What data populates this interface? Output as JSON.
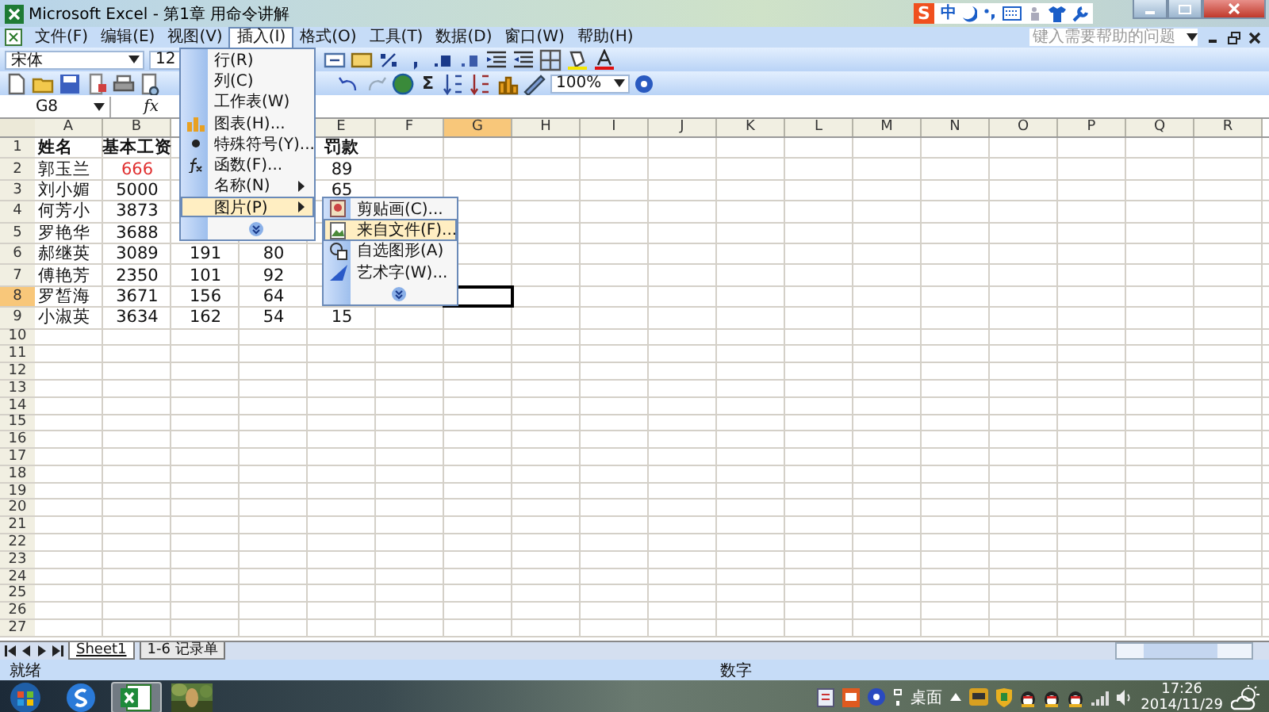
{
  "window": {
    "title": "Microsoft Excel - 第1章 用命令讲解"
  },
  "ime_bar": {
    "logo": "S",
    "mode": "中"
  },
  "menu_bar": [
    {
      "label": "文件(F)",
      "selected": false
    },
    {
      "label": "编辑(E)",
      "selected": false
    },
    {
      "label": "视图(V)",
      "selected": false
    },
    {
      "label": "插入(I)",
      "selected": true
    },
    {
      "label": "格式(O)",
      "selected": false
    },
    {
      "label": "工具(T)",
      "selected": false
    },
    {
      "label": "数据(D)",
      "selected": false
    },
    {
      "label": "窗口(W)",
      "selected": false
    },
    {
      "label": "帮助(H)",
      "selected": false
    }
  ],
  "help_box": {
    "placeholder": "键入需要帮助的问题"
  },
  "formatting_toolbar": {
    "font": "宋体",
    "size": "12"
  },
  "standard_toolbar": {
    "sum": "Σ",
    "zoom": "100%"
  },
  "formula_bar": {
    "name_box": "G8",
    "fx": "fx"
  },
  "columns_left": [
    {
      "label": "A",
      "selected": false
    },
    {
      "label": "B",
      "selected": false
    }
  ],
  "columns_right": [
    {
      "label": "E",
      "selected": false
    },
    {
      "label": "F",
      "selected": false
    },
    {
      "label": "G",
      "selected": true
    },
    {
      "label": "H",
      "selected": false
    },
    {
      "label": "I",
      "selected": false
    },
    {
      "label": "J",
      "selected": false
    },
    {
      "label": "K",
      "selected": false
    },
    {
      "label": "L",
      "selected": false
    },
    {
      "label": "M",
      "selected": false
    },
    {
      "label": "N",
      "selected": false
    },
    {
      "label": "O",
      "selected": false
    },
    {
      "label": "P",
      "selected": false
    },
    {
      "label": "Q",
      "selected": false
    },
    {
      "label": "R",
      "selected": false
    }
  ],
  "rows": [
    {
      "label": "1",
      "selected": false,
      "cells": [
        {
          "text": "姓名",
          "bold": true
        },
        {
          "text": "基本工资",
          "bold": true
        },
        null,
        null,
        {
          "text": "罚款",
          "bold": true
        }
      ]
    },
    {
      "label": "2",
      "selected": false,
      "cells": [
        {
          "text": "郭玉兰",
          "bold": false
        },
        {
          "text": "666",
          "bold": false,
          "color": "#e03030"
        },
        null,
        null,
        {
          "text": "89",
          "bold": false
        }
      ]
    },
    {
      "label": "3",
      "selected": false,
      "cells": [
        {
          "text": "刘小媚",
          "bold": false
        },
        {
          "text": "5000",
          "bold": false
        },
        null,
        null,
        {
          "text": "65",
          "bold": false
        }
      ]
    },
    {
      "label": "4",
      "selected": false,
      "cells": [
        {
          "text": "何芳小",
          "bold": false
        },
        {
          "text": "3873",
          "bold": false
        }
      ]
    },
    {
      "label": "5",
      "selected": false,
      "cells": [
        {
          "text": "罗艳华",
          "bold": false
        },
        {
          "text": "3688",
          "bold": false
        }
      ]
    },
    {
      "label": "6",
      "selected": false,
      "cells": [
        {
          "text": "郝继英",
          "bold": false
        },
        {
          "text": "3089",
          "bold": false
        },
        {
          "text": "191",
          "bold": false
        },
        {
          "text": "80",
          "bold": false
        }
      ]
    },
    {
      "label": "7",
      "selected": false,
      "cells": [
        {
          "text": "傅艳芳",
          "bold": false
        },
        {
          "text": "2350",
          "bold": false
        },
        {
          "text": "101",
          "bold": false
        },
        {
          "text": "92",
          "bold": false
        }
      ]
    },
    {
      "label": "8",
      "selected": true,
      "cells": [
        {
          "text": "罗皙海",
          "bold": false
        },
        {
          "text": "3671",
          "bold": false
        },
        {
          "text": "156",
          "bold": false
        },
        {
          "text": "64",
          "bold": false
        }
      ]
    },
    {
      "label": "9",
      "selected": false,
      "cells": [
        {
          "text": "小淑英",
          "bold": false
        },
        {
          "text": "3634",
          "bold": false
        },
        {
          "text": "162",
          "bold": false
        },
        {
          "text": "54",
          "bold": false
        },
        {
          "text": "15",
          "bold": false
        }
      ]
    },
    {
      "label": "10",
      "selected": false
    },
    {
      "label": "11",
      "selected": false
    },
    {
      "label": "12",
      "selected": false
    },
    {
      "label": "13",
      "selected": false
    },
    {
      "label": "14",
      "selected": false
    },
    {
      "label": "15",
      "selected": false
    },
    {
      "label": "16",
      "selected": false
    },
    {
      "label": "17",
      "selected": false
    },
    {
      "label": "18",
      "selected": false
    },
    {
      "label": "19",
      "selected": false
    },
    {
      "label": "20",
      "selected": false
    },
    {
      "label": "21",
      "selected": false
    },
    {
      "label": "22",
      "selected": false
    },
    {
      "label": "23",
      "selected": false
    },
    {
      "label": "24",
      "selected": false
    },
    {
      "label": "25",
      "selected": false
    },
    {
      "label": "26",
      "selected": false
    },
    {
      "label": "27",
      "selected": false
    }
  ],
  "insert_menu": [
    {
      "kind": "item",
      "label": "行(R)",
      "submenu": false,
      "selected": false
    },
    {
      "kind": "item",
      "label": "列(C)",
      "submenu": false,
      "selected": false
    },
    {
      "kind": "item",
      "label": "工作表(W)",
      "submenu": false,
      "selected": false
    },
    {
      "kind": "item",
      "label": "图表(H)...",
      "submenu": false,
      "selected": false
    },
    {
      "kind": "item",
      "label": "特殊符号(Y)...",
      "submenu": false,
      "selected": false
    },
    {
      "kind": "item",
      "label": "函数(F)...",
      "submenu": false,
      "selected": false
    },
    {
      "kind": "item",
      "label": "名称(N)",
      "submenu": true,
      "selected": false
    },
    {
      "kind": "item",
      "label": "图片(P)",
      "submenu": true,
      "selected": true
    },
    {
      "kind": "expand"
    }
  ],
  "picture_submenu": [
    {
      "kind": "item",
      "label": "剪贴画(C)...",
      "selected": false
    },
    {
      "kind": "item",
      "label": "来自文件(F)...",
      "selected": true
    },
    {
      "kind": "item",
      "label": "自选图形(A)",
      "selected": false
    },
    {
      "kind": "item",
      "label": "艺术字(W)...",
      "selected": false
    },
    {
      "kind": "expand"
    }
  ],
  "sheet_tabs": [
    {
      "label": "Sheet1",
      "selected": true
    },
    {
      "label": "1-6 记录单",
      "selected": false
    }
  ],
  "status_bar": {
    "left": "就绪",
    "right": "数字"
  },
  "taskbar": {
    "buttons": [
      {
        "kind": "start",
        "selected": false
      },
      {
        "kind": "browser",
        "selected": false
      },
      {
        "kind": "excel",
        "selected": true
      },
      {
        "kind": "picture",
        "selected": false
      }
    ],
    "desktop": "桌面",
    "time": "17:26",
    "date": "2014/11/29"
  }
}
